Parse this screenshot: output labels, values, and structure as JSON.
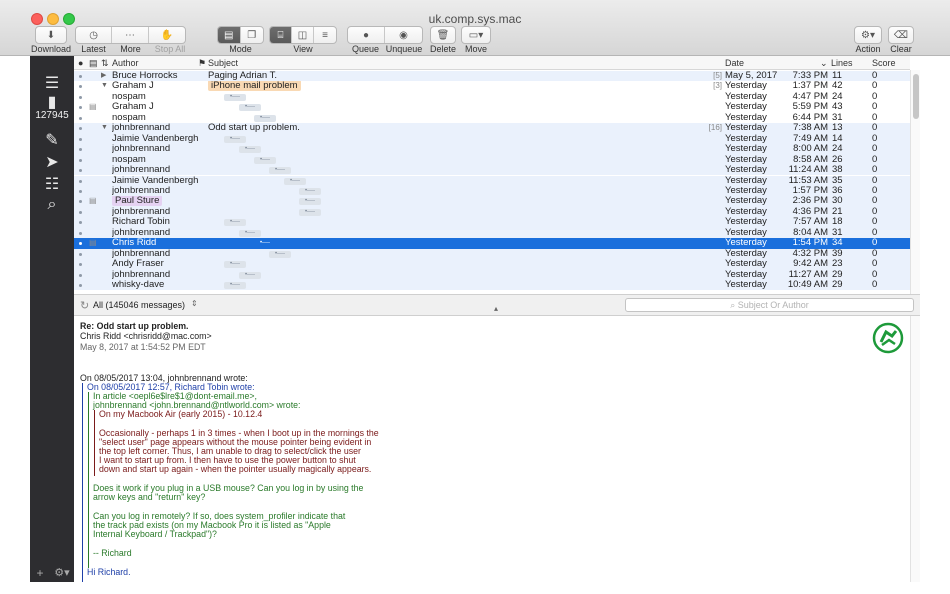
{
  "window": {
    "title": "uk.comp.sys.mac"
  },
  "toolbar": {
    "download": "Download",
    "latest": "Latest",
    "more": "More",
    "stop_all": "Stop All",
    "mode": "Mode",
    "view": "View",
    "queue": "Queue",
    "unqueue": "Unqueue",
    "delete": "Delete",
    "move": "Move",
    "action": "Action",
    "clear": "Clear"
  },
  "sidebar": {
    "count": "127945"
  },
  "columns": {
    "author": "Author",
    "subject": "Subject",
    "date": "Date",
    "lines": "Lines",
    "score": "Score"
  },
  "messages": [
    {
      "author": "Bruce Horrocks",
      "subject": "Paging Adrian T.",
      "count": "[5]",
      "date": "May 5, 2017",
      "time": "7:33 PM",
      "lines": "11",
      "score": "0"
    },
    {
      "author": "Graham J",
      "subject": "iPhone mail problem",
      "count": "[3]",
      "date": "Yesterday",
      "time": "1:37 PM",
      "lines": "42",
      "score": "0"
    },
    {
      "author": "nospam",
      "subject": "",
      "count": "",
      "date": "Yesterday",
      "time": "4:47 PM",
      "lines": "24",
      "score": "0"
    },
    {
      "author": "Graham J",
      "subject": "",
      "count": "",
      "date": "Yesterday",
      "time": "5:59 PM",
      "lines": "43",
      "score": "0"
    },
    {
      "author": "nospam",
      "subject": "",
      "count": "",
      "date": "Yesterday",
      "time": "6:44 PM",
      "lines": "31",
      "score": "0"
    },
    {
      "author": "johnbrennand",
      "subject": "Odd start up problem.",
      "count": "[16]",
      "date": "Yesterday",
      "time": "7:38 AM",
      "lines": "13",
      "score": "0"
    },
    {
      "author": "Jaimie Vandenbergh",
      "subject": "",
      "count": "",
      "date": "Yesterday",
      "time": "7:49 AM",
      "lines": "14",
      "score": "0"
    },
    {
      "author": "johnbrennand",
      "subject": "",
      "count": "",
      "date": "Yesterday",
      "time": "8:00 AM",
      "lines": "24",
      "score": "0"
    },
    {
      "author": "nospam",
      "subject": "",
      "count": "",
      "date": "Yesterday",
      "time": "8:58 AM",
      "lines": "26",
      "score": "0"
    },
    {
      "author": "johnbrennand",
      "subject": "",
      "count": "",
      "date": "Yesterday",
      "time": "11:24 AM",
      "lines": "38",
      "score": "0"
    },
    {
      "author": "Jaimie Vandenbergh",
      "subject": "",
      "count": "",
      "date": "Yesterday",
      "time": "11:53 AM",
      "lines": "35",
      "score": "0"
    },
    {
      "author": "johnbrennand",
      "subject": "",
      "count": "",
      "date": "Yesterday",
      "time": "1:57 PM",
      "lines": "36",
      "score": "0"
    },
    {
      "author": "Paul Sture",
      "subject": "",
      "count": "",
      "date": "Yesterday",
      "time": "2:36 PM",
      "lines": "30",
      "score": "0"
    },
    {
      "author": "johnbrennand",
      "subject": "",
      "count": "",
      "date": "Yesterday",
      "time": "4:36 PM",
      "lines": "21",
      "score": "0"
    },
    {
      "author": "Richard Tobin",
      "subject": "",
      "count": "",
      "date": "Yesterday",
      "time": "7:57 AM",
      "lines": "18",
      "score": "0"
    },
    {
      "author": "johnbrennand",
      "subject": "",
      "count": "",
      "date": "Yesterday",
      "time": "8:04 AM",
      "lines": "31",
      "score": "0"
    },
    {
      "author": "Chris Ridd",
      "subject": "",
      "count": "",
      "date": "Yesterday",
      "time": "1:54 PM",
      "lines": "34",
      "score": "0"
    },
    {
      "author": "johnbrennand",
      "subject": "",
      "count": "",
      "date": "Yesterday",
      "time": "4:32 PM",
      "lines": "39",
      "score": "0"
    },
    {
      "author": "Andy Fraser",
      "subject": "",
      "count": "",
      "date": "Yesterday",
      "time": "9:42 AM",
      "lines": "23",
      "score": "0"
    },
    {
      "author": "johnbrennand",
      "subject": "",
      "count": "",
      "date": "Yesterday",
      "time": "11:27 AM",
      "lines": "29",
      "score": "0"
    },
    {
      "author": "whisky-dave",
      "subject": "",
      "count": "",
      "date": "Yesterday",
      "time": "10:49 AM",
      "lines": "29",
      "score": "0"
    }
  ],
  "filter": {
    "label": "All (145046 messages)",
    "search_placeholder": "Subject Or Author"
  },
  "reader": {
    "subject": "Re: Odd start up problem.",
    "from": "Chris Ridd <chrisridd@mac.com>",
    "date": "May 8, 2017 at 1:54:52 PM EDT",
    "l0": "On 08/05/2017 13:04, johnbrennand wrote:",
    "l1": "On 08/05/2017 12:57, Richard Tobin wrote:",
    "l2": "In article <oepl6e$lre$1@dont-email.me>,",
    "l3": "johnbrennand <john.brennand@ntlworld.com> wrote:",
    "l4": "On my Macbook Air (early 2015) - 10.12.4",
    "l5": "Occasionally - perhaps 1 in 3 times - when I boot up in the mornings the",
    "l6": "\"select user\" page appears without the mouse pointer being evident in",
    "l7": "the top left corner. Thus, I am unable to drag to select/click the user",
    "l8": "I want to start up from. I then have to use the power button to shut",
    "l9": "down and start up again - when the pointer usually magically appears.",
    "l10": "Does it work if you plug in a USB mouse? Can you log in by using the",
    "l11": "arrow keys and \"return\" key?",
    "l12": "Can you log in remotely? If so, does system_profiler indicate that",
    "l13": "the track pad exists (on my Macbook Pro it is listed as \"Apple",
    "l14": "Internal Keyboard / Trackpad\")?",
    "l15": "-- Richard",
    "l16": "Hi Richard."
  },
  "colors": {
    "selection": "#1a6fdc",
    "alt_row": "#eaf1fc",
    "sidebar": "#2d2d30",
    "quote1": "#1e3fa8",
    "quote2": "#2a7a2a",
    "quote3": "#7a1a1a"
  }
}
